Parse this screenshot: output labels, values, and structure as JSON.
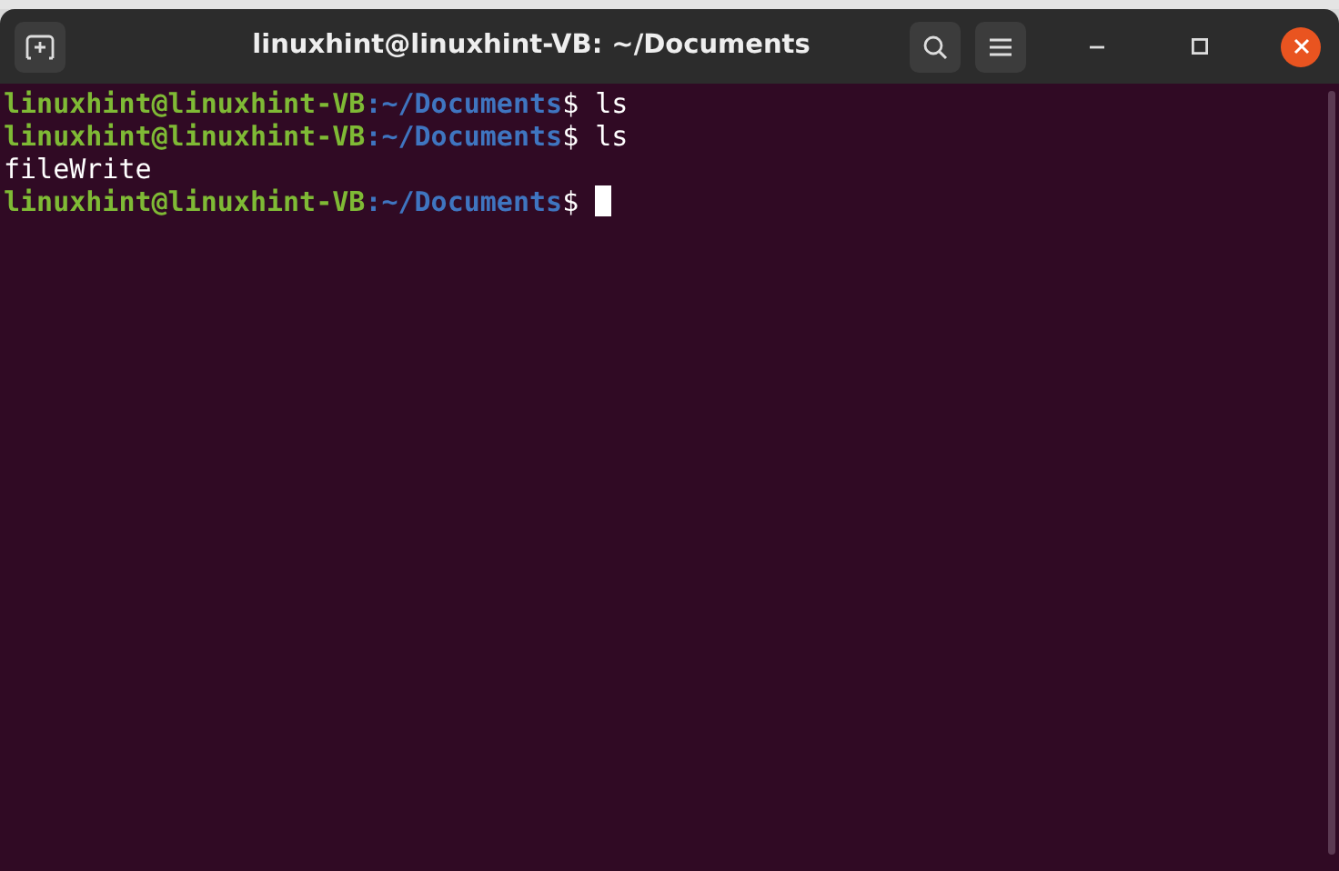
{
  "window": {
    "title": "linuxhint@linuxhint-VB: ~/Documents"
  },
  "terminal": {
    "lines": [
      {
        "kind": "prompt",
        "user_host": "linuxhint@linuxhint-VB",
        "path": ":~/Documents",
        "symbol": "$",
        "command": "ls",
        "cursor": false
      },
      {
        "kind": "prompt",
        "user_host": "linuxhint@linuxhint-VB",
        "path": ":~/Documents",
        "symbol": "$",
        "command": "ls",
        "cursor": false
      },
      {
        "kind": "output",
        "text": "fileWrite",
        "cursor": false
      },
      {
        "kind": "prompt",
        "user_host": "linuxhint@linuxhint-VB",
        "path": ":~/Documents",
        "symbol": "$",
        "cursor": true
      }
    ]
  }
}
